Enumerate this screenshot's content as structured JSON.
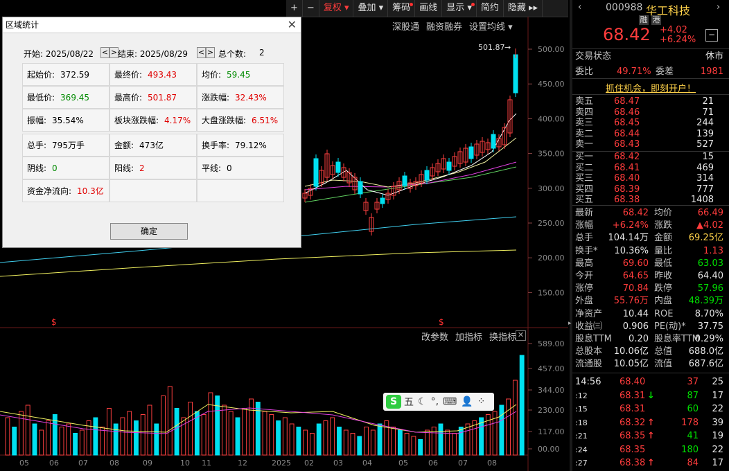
{
  "toolbar": {
    "items": [
      {
        "label": "+",
        "color": "#e0e0e0"
      },
      {
        "label": "−",
        "color": "#e0e0e0"
      },
      {
        "label": "复权 ▾",
        "color": "#ff3c3c"
      },
      {
        "label": "叠加 ▾",
        "color": "#e0e0e0"
      },
      {
        "label": "筹码",
        "color": "#e0e0e0",
        "dot": true
      },
      {
        "label": "画线",
        "color": "#e0e0e0"
      },
      {
        "label": "显示 ▾",
        "color": "#e0e0e0",
        "dot": true
      },
      {
        "label": "简约",
        "color": "#e0e0e0"
      },
      {
        "label": "隐藏 ▸▸",
        "color": "#e0e0e0"
      }
    ]
  },
  "main_chart": {
    "menu": [
      "深股通",
      "融资融券",
      "设置均线 ▾"
    ],
    "yticks": [
      "500.00",
      "450.00",
      "400.00",
      "350.00",
      "300.00",
      "250.00",
      "200.00",
      "150.00"
    ],
    "high_label": "501.87",
    "s_marker": "$"
  },
  "vol_chart": {
    "menu": [
      "改参数",
      "加指标",
      "换指标"
    ],
    "yticks": [
      "589.00",
      "457.00",
      "344.00",
      "230.00",
      "117.00",
      "00.00"
    ],
    "xticks": [
      "05",
      "06",
      "07",
      "08",
      "09",
      "10",
      "11",
      "12",
      "2025",
      "02",
      "03",
      "04",
      "05",
      "06",
      "07",
      "08"
    ]
  },
  "ime": {
    "label": "五",
    "icons": [
      "moon",
      "comma",
      "keyboard",
      "user",
      "grid"
    ]
  },
  "dialog": {
    "title": "区域统计",
    "start_label": "开始: 2025/08/22",
    "end_label": "结束: 2025/08/29",
    "count_label": "总个数:",
    "count_value": "2",
    "prev": "<",
    "next": ">",
    "cells": [
      {
        "label": "起始价:",
        "value": "372.59",
        "tone": ""
      },
      {
        "label": "最终价:",
        "value": "493.43",
        "tone": "red"
      },
      {
        "label": "均价:",
        "value": "59.45",
        "tone": "green"
      },
      {
        "label": "最低价:",
        "value": "369.45",
        "tone": "green"
      },
      {
        "label": "最高价:",
        "value": "501.87",
        "tone": "red"
      },
      {
        "label": "涨跌幅:",
        "value": "32.43%",
        "tone": "red"
      },
      {
        "label": "振幅:",
        "value": "35.54%",
        "tone": ""
      },
      {
        "label": "板块涨跌幅:",
        "value": "4.17%",
        "tone": "red"
      },
      {
        "label": "大盘涨跌幅:",
        "value": "6.51%",
        "tone": "red"
      },
      {
        "label": "总手:",
        "value": "795万手",
        "tone": ""
      },
      {
        "label": "金额:",
        "value": "473亿",
        "tone": ""
      },
      {
        "label": "换手率:",
        "value": "79.12%",
        "tone": ""
      },
      {
        "label": "阴线:",
        "value": "0",
        "tone": "green"
      },
      {
        "label": "阳线:",
        "value": "2",
        "tone": "red"
      },
      {
        "label": "平线:",
        "value": "0",
        "tone": ""
      },
      {
        "label": "资金净流向:",
        "value": "10.3亿",
        "tone": "red"
      }
    ],
    "ok": "确定"
  },
  "stock": {
    "code": "000988",
    "name": "华工科技",
    "tags": [
      "融",
      "港"
    ],
    "price": "68.42",
    "change": "+4.02",
    "change_pct": "+6.24%",
    "status_label": "交易状态",
    "status_value": "休市",
    "weibi_label": "委比",
    "weibi_value": "49.71%",
    "weicha_label": "委差",
    "weicha_value": "1981",
    "promo": "抓住机会，即刻开户！"
  },
  "order_book": {
    "sell": [
      {
        "label": "卖五",
        "price": "68.47",
        "vol": "21"
      },
      {
        "label": "卖四",
        "price": "68.46",
        "vol": "71"
      },
      {
        "label": "卖三",
        "price": "68.45",
        "vol": "244"
      },
      {
        "label": "卖二",
        "price": "68.44",
        "vol": "139"
      },
      {
        "label": "卖一",
        "price": "68.43",
        "vol": "527"
      }
    ],
    "buy": [
      {
        "label": "买一",
        "price": "68.42",
        "vol": "15"
      },
      {
        "label": "买二",
        "price": "68.41",
        "vol": "469"
      },
      {
        "label": "买三",
        "price": "68.40",
        "vol": "314"
      },
      {
        "label": "买四",
        "price": "68.39",
        "vol": "777"
      },
      {
        "label": "买五",
        "price": "68.38",
        "vol": "1408"
      }
    ]
  },
  "stats": [
    {
      "l1": "最新",
      "v1": "68.42",
      "c1": "up",
      "l2": "均价",
      "v2": "66.49",
      "c2": "up"
    },
    {
      "l1": "涨幅",
      "v1": "+6.24%",
      "c1": "up",
      "l2": "涨跌",
      "v2": "▲4.02",
      "c2": "up"
    },
    {
      "l1": "总手",
      "v1": "104.14万",
      "c1": "wh",
      "l2": "金额",
      "v2": "69.25亿",
      "c2": "yl"
    },
    {
      "l1": "换手*",
      "v1": "10.36%",
      "c1": "wh",
      "l2": "量比",
      "v2": "1.13",
      "c2": "up"
    },
    {
      "l1": "最高",
      "v1": "69.60",
      "c1": "up",
      "l2": "最低",
      "v2": "63.03",
      "c2": "dn"
    },
    {
      "l1": "今开",
      "v1": "64.65",
      "c1": "up",
      "l2": "昨收",
      "v2": "64.40",
      "c2": "wh"
    },
    {
      "l1": "涨停",
      "v1": "70.84",
      "c1": "up",
      "l2": "跌停",
      "v2": "57.96",
      "c2": "dn"
    },
    {
      "l1": "外盘",
      "v1": "55.76万",
      "c1": "up",
      "l2": "内盘",
      "v2": "48.39万",
      "c2": "dn"
    },
    {
      "l1": "净资产",
      "v1": "10.44",
      "c1": "wh",
      "l2": "ROE",
      "v2": "8.70%",
      "c2": "wh"
    },
    {
      "l1": "收益㈢",
      "v1": "0.906",
      "c1": "wh",
      "l2": "PE(动)*",
      "v2": "37.75",
      "c2": "wh"
    },
    {
      "l1": "股息TTM",
      "v1": "0.20",
      "c1": "wh",
      "l2": "股息率TTM",
      "v2": "0.29%",
      "c2": "wh"
    },
    {
      "l1": "总股本",
      "v1": "10.06亿",
      "c1": "wh",
      "l2": "总值",
      "v2": "688.0亿",
      "c2": "wh"
    },
    {
      "l1": "流通股",
      "v1": "10.05亿",
      "c1": "wh",
      "l2": "流值",
      "v2": "687.6亿",
      "c2": "wh"
    }
  ],
  "ticks": [
    {
      "time": "14:56",
      "price": "68.40",
      "arrow": "",
      "vol": "37",
      "vc": "up",
      "n": "25"
    },
    {
      "time": ":12",
      "price": "68.31",
      "arrow": "↓",
      "vol": "87",
      "vc": "dn",
      "n": "17"
    },
    {
      "time": ":15",
      "price": "68.31",
      "arrow": "",
      "vol": "60",
      "vc": "dn",
      "n": "22"
    },
    {
      "time": ":18",
      "price": "68.32",
      "arrow": "↑",
      "vol": "178",
      "vc": "up",
      "n": "39"
    },
    {
      "time": ":21",
      "price": "68.35",
      "arrow": "↑",
      "vol": "41",
      "vc": "dn",
      "n": "19"
    },
    {
      "time": ":24",
      "price": "68.35",
      "arrow": "",
      "vol": "180",
      "vc": "dn",
      "n": "22"
    },
    {
      "time": ":27",
      "price": "68.38",
      "arrow": "↑",
      "vol": "84",
      "vc": "up",
      "n": "17"
    }
  ]
}
